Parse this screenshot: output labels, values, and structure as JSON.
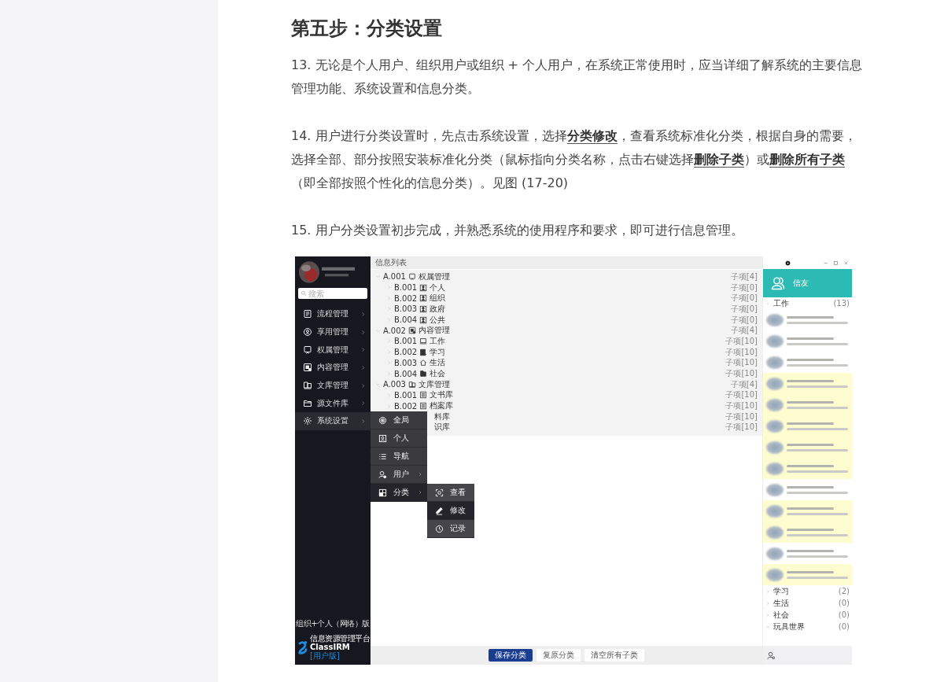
{
  "article": {
    "heading": "第五步：分类设置",
    "paragraphs": [
      "13. 无论是个人用户、组织用户或组织 + 个人用户，在系统正常使用时，应当详细了解系统的主要信息管理功能、系统设置和信息分类。",
      "14. 用户进行分类设置时，先点击系统设置，选择**分类修改**，查看系统标准化分类，根据自身的需要，选择全部、部分按照安装标准化分类（鼠标指向分类名称，点击右键选择**删除子类**）或**删除所有子类**（即全部按照个性化的信息分类）。见图 (17-20)",
      "15. 用户分类设置初步完成，并熟悉系统的使用程序和要求，即可进行信息管理。"
    ]
  },
  "app": {
    "sidebar": {
      "search_placeholder": "搜索",
      "items": [
        {
          "label": "流程管理",
          "selected": false
        },
        {
          "label": "享用管理",
          "selected": false
        },
        {
          "label": "权属管理",
          "selected": false
        },
        {
          "label": "内容管理",
          "selected": false
        },
        {
          "label": "文库管理",
          "selected": false
        },
        {
          "label": "源文件库",
          "selected": false
        },
        {
          "label": "系统设置",
          "selected": true
        }
      ],
      "edition": "组织+个人（网络）版",
      "logo": {
        "title": "信息资源管理平台",
        "brand": "ClassIRM",
        "badge": "[用户版]"
      }
    },
    "list_header": "信息列表",
    "tree": [
      {
        "code": "A.001",
        "label": "权属管理",
        "count": "子项[4]",
        "expanded": true,
        "children": [
          {
            "code": "B.001",
            "label": "个人",
            "count": "子项[0]",
            "expanded": false
          },
          {
            "code": "B.002",
            "label": "组织",
            "count": "子项[0]",
            "expanded": false
          },
          {
            "code": "B.003",
            "label": "政府",
            "count": "子项[0]",
            "expanded": false
          },
          {
            "code": "B.004",
            "label": "公共",
            "count": "子项[0]",
            "expanded": false
          }
        ]
      },
      {
        "code": "A.002",
        "label": "内容管理",
        "count": "子项[4]",
        "expanded": true,
        "children": [
          {
            "code": "B.001",
            "label": "工作",
            "count": "子项[10]",
            "expanded": false
          },
          {
            "code": "B.002",
            "label": "学习",
            "count": "子项[10]",
            "expanded": false
          },
          {
            "code": "B.003",
            "label": "生活",
            "count": "子项[10]",
            "expanded": false
          },
          {
            "code": "B.004",
            "label": "社会",
            "count": "子项[10]",
            "expanded": false
          }
        ]
      },
      {
        "code": "A.003",
        "label": "文库管理",
        "count": "子项[4]",
        "expanded": true,
        "children": [
          {
            "code": "B.001",
            "label": "文书库",
            "count": "子项[10]",
            "expanded": false
          },
          {
            "code": "B.002",
            "label": "档案库",
            "count": "子项[10]",
            "expanded": false
          },
          {
            "label": "料库",
            "count": "子项[10]"
          },
          {
            "label": "识库",
            "count": "子项[10]"
          }
        ]
      }
    ],
    "context_menu": [
      {
        "label": "全局",
        "has_submenu": false,
        "selected": false
      },
      {
        "label": "个人",
        "has_submenu": false,
        "selected": false
      },
      {
        "label": "导航",
        "has_submenu": false,
        "selected": false
      },
      {
        "label": "用户",
        "has_submenu": true,
        "selected": false
      },
      {
        "label": "分类",
        "has_submenu": true,
        "selected": true
      }
    ],
    "submenu": [
      {
        "label": "查看",
        "selected": false
      },
      {
        "label": "修改",
        "selected": true
      },
      {
        "label": "记录",
        "selected": false
      }
    ],
    "buttons": [
      {
        "label": "保存分类",
        "primary": true
      },
      {
        "label": "复原分类",
        "primary": false
      },
      {
        "label": "清空所有子类",
        "primary": false
      }
    ],
    "contacts_panel": {
      "title": "信友",
      "groups": [
        {
          "name": "工作",
          "count": "(13)",
          "expanded": true,
          "contacts": [
            {
              "highlighted": false
            },
            {
              "highlighted": false
            },
            {
              "highlighted": false
            },
            {
              "highlighted": true
            },
            {
              "highlighted": true
            },
            {
              "highlighted": true
            },
            {
              "highlighted": true
            },
            {
              "highlighted": true
            },
            {
              "highlighted": false
            },
            {
              "highlighted": true
            },
            {
              "highlighted": true
            },
            {
              "highlighted": false
            },
            {
              "highlighted": true
            }
          ]
        },
        {
          "name": "学习",
          "count": "(2)",
          "expanded": false
        },
        {
          "name": "生活",
          "count": "(0)",
          "expanded": false
        },
        {
          "name": "社会",
          "count": "(0)",
          "expanded": false
        },
        {
          "name": "玩具世界",
          "count": "(0)",
          "expanded": true
        }
      ]
    }
  }
}
